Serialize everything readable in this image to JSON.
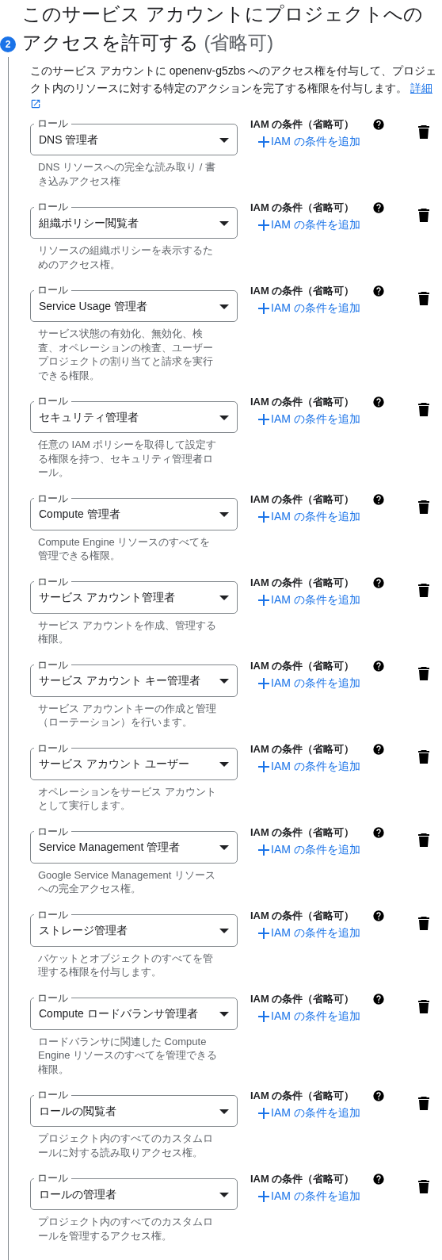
{
  "step": {
    "number": "2",
    "title": "このサービス アカウントにプロジェクトへのアクセスを許可する",
    "optional": "(省略可)",
    "description": "このサービス アカウントに openenv-g5zbs へのアクセス権を付与して、プロジェクト内のリソースに対する特定のアクションを完了する権限を付与します。",
    "link": "詳細"
  },
  "roles": [
    {
      "label": "ロール",
      "value": "DNS 管理者",
      "description": "DNS リソースへの完全な読み取り / 書き込みアクセス権",
      "condition_label": "IAM の条件（省略可）",
      "add_condition": "IAM の条件を追加"
    },
    {
      "label": "ロール",
      "value": "組織ポリシー閲覧者",
      "description": "リソースの組織ポリシーを表示するためのアクセス権。",
      "condition_label": "IAM の条件（省略可）",
      "add_condition": "IAM の条件を追加"
    },
    {
      "label": "ロール",
      "value": "Service Usage 管理者",
      "description": "サービス状態の有効化、無効化、検査、オペレーションの検査、ユーザープロジェクトの割り当てと請求を実行できる権限。",
      "condition_label": "IAM の条件（省略可）",
      "add_condition": "IAM の条件を追加"
    },
    {
      "label": "ロール",
      "value": "セキュリティ管理者",
      "description": "任意の IAM ポリシーを取得して設定する権限を持つ、セキュリティ管理者ロール。",
      "condition_label": "IAM の条件（省略可）",
      "add_condition": "IAM の条件を追加"
    },
    {
      "label": "ロール",
      "value": "Compute 管理者",
      "description": "Compute Engine リソースのすべてを管理できる権限。",
      "condition_label": "IAM の条件（省略可）",
      "add_condition": "IAM の条件を追加"
    },
    {
      "label": "ロール",
      "value": "サービス アカウント管理者",
      "description": "サービス アカウントを作成、管理する権限。",
      "condition_label": "IAM の条件（省略可）",
      "add_condition": "IAM の条件を追加"
    },
    {
      "label": "ロール",
      "value": "サービス アカウント キー管理者",
      "description": "サービス アカウントキーの作成と管理（ローテーション）を行います。",
      "condition_label": "IAM の条件（省略可）",
      "add_condition": "IAM の条件を追加"
    },
    {
      "label": "ロール",
      "value": "サービス アカウント ユーザー",
      "description": "オペレーションをサービス アカウントとして実行します。",
      "condition_label": "IAM の条件（省略可）",
      "add_condition": "IAM の条件を追加"
    },
    {
      "label": "ロール",
      "value": "Service Management 管理者",
      "description": "Google Service Management リソースへの完全アクセス権。",
      "condition_label": "IAM の条件（省略可）",
      "add_condition": "IAM の条件を追加"
    },
    {
      "label": "ロール",
      "value": "ストレージ管理者",
      "description": "バケットとオブジェクトのすべてを管理する権限を付与します。",
      "condition_label": "IAM の条件（省略可）",
      "add_condition": "IAM の条件を追加"
    },
    {
      "label": "ロール",
      "value": "Compute ロードバランサ管理者",
      "description": "ロードバランサに関連した Compute Engine リソースのすべてを管理できる権限。",
      "condition_label": "IAM の条件（省略可）",
      "add_condition": "IAM の条件を追加"
    },
    {
      "label": "ロール",
      "value": "ロールの閲覧者",
      "description": "プロジェクト内のすべてのカスタムロールに対する読み取りアクセス権。",
      "condition_label": "IAM の条件（省略可）",
      "add_condition": "IAM の条件を追加"
    },
    {
      "label": "ロール",
      "value": "ロールの管理者",
      "description": "プロジェクト内のすべてのカスタムロールを管理するアクセス権。",
      "condition_label": "IAM の条件（省略可）",
      "add_condition": "IAM の条件を追加"
    }
  ]
}
